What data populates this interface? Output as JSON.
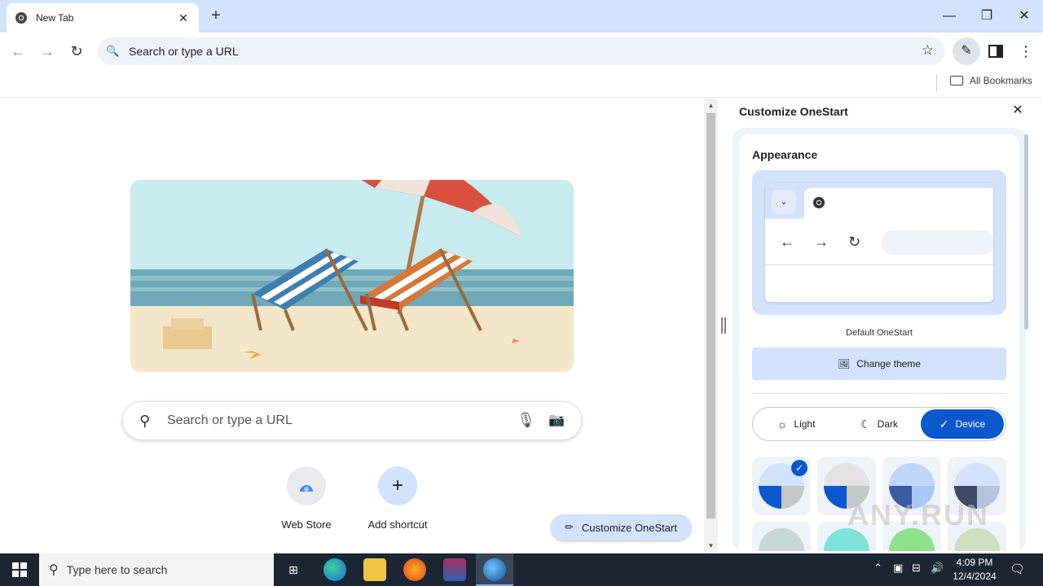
{
  "browser": {
    "tab_title": "New Tab",
    "tab_close": "✕",
    "new_tab": "+",
    "omnibox_placeholder": "Search or type a URL",
    "bookmarks_all": "All Bookmarks"
  },
  "window_controls": {
    "minimize": "—",
    "restore": "❐",
    "close": "✕"
  },
  "ntp": {
    "search_placeholder": "Search or type a URL",
    "shortcuts": [
      {
        "label": "Web Store"
      },
      {
        "label": "Add shortcut",
        "icon": "+"
      }
    ],
    "customize_label": "Customize OneStart"
  },
  "panel": {
    "title": "Customize OneStart",
    "appearance_heading": "Appearance",
    "theme_name": "Default OneStart",
    "change_theme_label": "Change theme",
    "modes": [
      {
        "label": "Light",
        "selected": false
      },
      {
        "label": "Dark",
        "selected": false
      },
      {
        "label": "Device",
        "selected": true
      }
    ],
    "swatches": [
      {
        "left": "#0b57d0",
        "right": "#c4c7c5",
        "top": "#d3e3fd",
        "selected": true
      },
      {
        "left": "#0b57d0",
        "right": "#c4c7c5",
        "top": "#e3e3e3",
        "selected": false
      },
      {
        "left": "#3b5ba5",
        "right": "#a8c7fa",
        "top": "#c2d7f8",
        "selected": false
      },
      {
        "left": "#3e4a61",
        "right": "#b3c3e0",
        "top": "#d3e3fd",
        "selected": false
      }
    ],
    "swatches_row2": [
      "#c8d8d8",
      "#7de3d8",
      "#8fe08a",
      "#cfe0c0"
    ],
    "accent": "#0b57d0"
  },
  "watermark": "ANY.RUN",
  "taskbar": {
    "search_placeholder": "Type here to search",
    "time": "4:09 PM",
    "date": "12/4/2024"
  }
}
